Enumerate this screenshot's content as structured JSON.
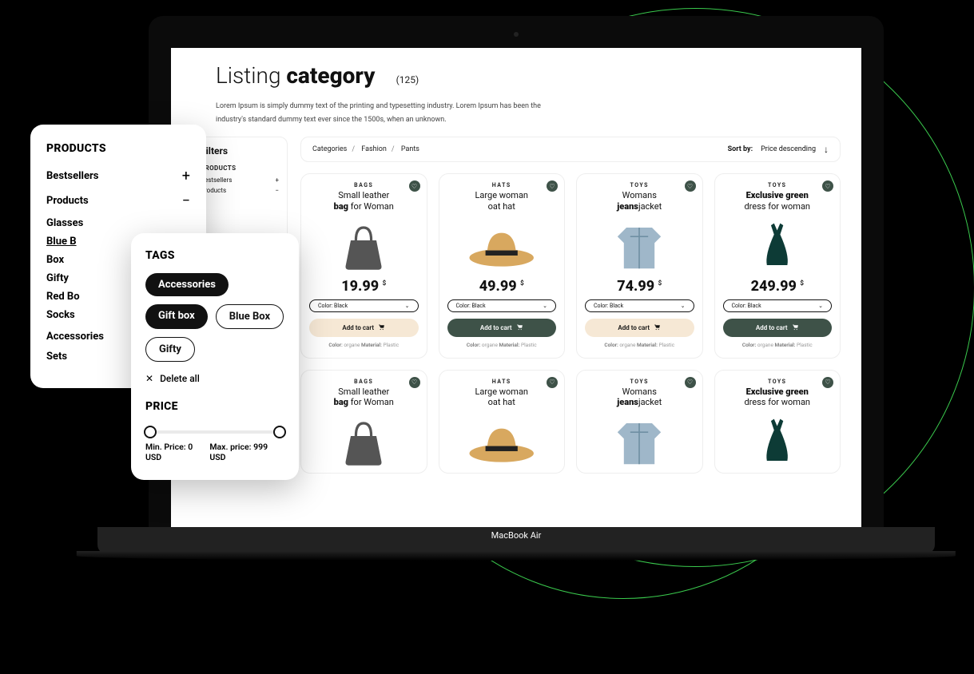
{
  "page": {
    "title_before": "Listing ",
    "title_bold": "category",
    "count": "(125)",
    "desc": "Lorem Ipsum is simply dummy text of the printing and typesetting industry. Lorem Ipsum has been the industry's standard dummy text ever since the 1500s, when an unknown."
  },
  "breadcrumbs": {
    "a": "Categories",
    "b": "Fashion",
    "c": "Pants"
  },
  "sort": {
    "label": "Sort by:",
    "value": "Price descending"
  },
  "sidebar": {
    "title": "Filters",
    "products_hdr": "PRODUCTS",
    "bestsellers": "Bestsellers",
    "products": "Products",
    "price_hdr": "PRICE",
    "min": "Min. Price: 0 USD",
    "max": "Max. price: 999 USD"
  },
  "products_panel": {
    "header": "PRODUCTS",
    "bestsellers": "Bestsellers",
    "products": "Products",
    "items": [
      "Glasses",
      "Blue B",
      "Box",
      "Gifty",
      "Red Bo",
      "Socks"
    ],
    "accessories": "Accessories",
    "sets": "Sets"
  },
  "tags_panel": {
    "header": "TAGS",
    "chips": [
      "Accessories",
      "Gift box",
      "Blue Box",
      "Gifty"
    ],
    "delete_all": "Delete all",
    "price_header": "PRICE",
    "min": "Min. Price: 0 USD",
    "max": "Max. price: 999 USD"
  },
  "card_common": {
    "select_label": "Color: Black",
    "add_label": "Add to cart",
    "meta_color_k": "Color:",
    "meta_color_v": "organe",
    "meta_mat_k": "Material:",
    "meta_mat_v": "Plastic"
  },
  "cards": [
    {
      "cat": "BAGS",
      "n1": "Small leather",
      "n2": "bag",
      "n3": " for Woman",
      "price": "19.99",
      "cur": "$",
      "btn": "beige",
      "icon": "bag"
    },
    {
      "cat": "HATS",
      "n1": "Large woman",
      "n2": "",
      "n3": "oat hat",
      "price": "49.99",
      "cur": "$",
      "btn": "dark",
      "icon": "hat"
    },
    {
      "cat": "TOYS",
      "n1": "Womans ",
      "n2": "jeans",
      "n3": "jacket",
      "price": "74.99",
      "cur": "$",
      "btn": "beige",
      "icon": "jacket"
    },
    {
      "cat": "TOYS",
      "n1": "Exclusive green",
      "n2": "",
      "n3": "dress for woman",
      "nBoldFirst": true,
      "price": "249.99",
      "cur": "$",
      "btn": "dark",
      "icon": "dress"
    }
  ],
  "laptop_label": "MacBook Air"
}
